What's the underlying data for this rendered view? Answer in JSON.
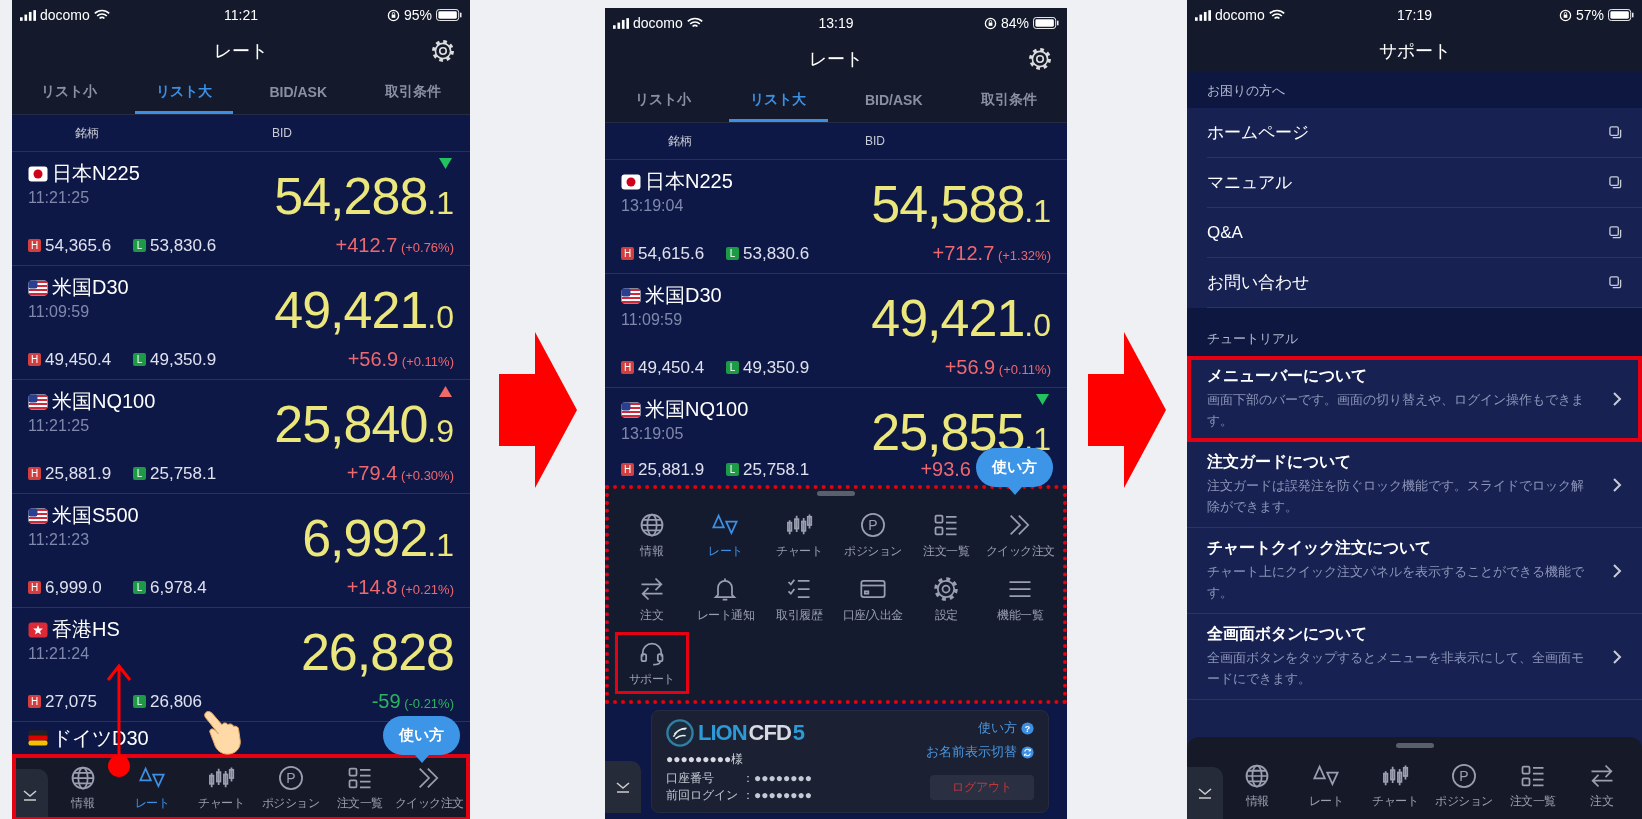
{
  "panels": [
    {
      "kind": "rates",
      "status_bar": {
        "carrier": "docomo",
        "time": "11:21",
        "battery": "95%"
      },
      "title": "レート",
      "tabs": [
        {
          "label": "リスト小",
          "selected": false
        },
        {
          "label": "リスト大",
          "selected": true
        },
        {
          "label": "BID/ASK",
          "selected": false
        },
        {
          "label": "取引条件",
          "selected": false
        }
      ],
      "columns": [
        "銘柄",
        "BID"
      ],
      "rows": [
        {
          "flag": {
            "kind": "jp"
          },
          "name": "日本N225",
          "time": "11:21:25",
          "price": "54,288",
          "price_decimal": ".1",
          "tick": {
            "kind": "down"
          },
          "high_badge": "H",
          "high": "54,365.6",
          "low_badge": "L",
          "low": "53,830.6",
          "rising": true,
          "change": "+412.7",
          "change_pct": "(+0.76%)"
        },
        {
          "flag": {
            "kind": "us"
          },
          "name": "米国D30",
          "time": "11:09:59",
          "price": "49,421",
          "price_decimal": ".0",
          "high_badge": "H",
          "high": "49,450.4",
          "low_badge": "L",
          "low": "49,350.9",
          "rising": true,
          "change": "+56.9",
          "change_pct": "(+0.11%)"
        },
        {
          "flag": {
            "kind": "us"
          },
          "name": "米国NQ100",
          "time": "11:21:25",
          "price": "25,840",
          "price_decimal": ".9",
          "tick": {
            "kind": "up"
          },
          "high_badge": "H",
          "high": "25,881.9",
          "low_badge": "L",
          "low": "25,758.1",
          "rising": true,
          "change": "+79.4",
          "change_pct": "(+0.30%)"
        },
        {
          "flag": {
            "kind": "us"
          },
          "name": "米国S500",
          "time": "11:21:23",
          "price": "6,992",
          "price_decimal": ".1",
          "high_badge": "H",
          "high": "6,999.0",
          "low_badge": "L",
          "low": "6,978.4",
          "rising": true,
          "change": "+14.8",
          "change_pct": "(+0.21%)"
        },
        {
          "flag": {
            "kind": "hk"
          },
          "name": "香港HS",
          "time": "11:21:24",
          "price": "26,828",
          "high_badge": "H",
          "high": "27,075",
          "low_badge": "L",
          "low": "26,806",
          "rising": false,
          "change": "-59",
          "change_pct": "(-0.21%)"
        }
      ],
      "cut_row": {
        "flag": {
          "kind": "de"
        },
        "name": "ドイツD30"
      },
      "help_bubble": "使い方",
      "nav": {
        "highlighted": true,
        "items": [
          {
            "kind": "info",
            "label": "情報",
            "selected": false
          },
          {
            "kind": "rate",
            "label": "レート",
            "selected": true
          },
          {
            "kind": "chart",
            "label": "チャート",
            "selected": false
          },
          {
            "kind": "position",
            "label": "ポジション",
            "icon_letter": "P",
            "selected": false
          },
          {
            "kind": "orders",
            "label": "注文一覧",
            "selected": false
          },
          {
            "kind": "quick",
            "label": "クイック注文",
            "selected": false
          }
        ]
      }
    },
    {
      "kind": "rates",
      "status_bar": {
        "carrier": "docomo",
        "time": "13:19",
        "battery": "84%"
      },
      "title": "レート",
      "tabs": [
        {
          "label": "リスト小",
          "selected": false
        },
        {
          "label": "リスト大",
          "selected": true
        },
        {
          "label": "BID/ASK",
          "selected": false
        },
        {
          "label": "取引条件",
          "selected": false
        }
      ],
      "columns": [
        "銘柄",
        "BID"
      ],
      "rows": [
        {
          "flag": {
            "kind": "jp"
          },
          "name": "日本N225",
          "time": "13:19:04",
          "price": "54,588",
          "price_decimal": ".1",
          "high_badge": "H",
          "high": "54,615.6",
          "low_badge": "L",
          "low": "53,830.6",
          "rising": true,
          "change": "+712.7",
          "change_pct": "(+1.32%)"
        },
        {
          "flag": {
            "kind": "us"
          },
          "name": "米国D30",
          "time": "11:09:59",
          "price": "49,421",
          "price_decimal": ".0",
          "high_badge": "H",
          "high": "49,450.4",
          "low_badge": "L",
          "low": "49,350.9",
          "rising": true,
          "change": "+56.9",
          "change_pct": "(+0.11%)"
        },
        {
          "flag": {
            "kind": "us"
          },
          "name": "米国NQ100",
          "time": "13:19:05",
          "price": "25,855",
          "price_decimal": ".1",
          "tick": {
            "kind": "down"
          },
          "high_badge": "H",
          "high": "25,881.9",
          "low_badge": "L",
          "low": "25,758.1",
          "rising": true,
          "change": "+93.6"
        }
      ],
      "help_bubble": "使い方",
      "menu_sheet": {
        "highlighted": true,
        "items": [
          {
            "kind": "info",
            "label": "情報",
            "selected": false,
            "highlighted": false
          },
          {
            "kind": "rate",
            "label": "レート",
            "selected": true,
            "highlighted": false
          },
          {
            "kind": "chart",
            "label": "チャート",
            "selected": false,
            "highlighted": false
          },
          {
            "kind": "position",
            "label": "ポジション",
            "icon_letter": "P",
            "selected": false,
            "highlighted": false
          },
          {
            "kind": "orders",
            "label": "注文一覧",
            "selected": false,
            "highlighted": false
          },
          {
            "kind": "quick",
            "label": "クイック注文",
            "selected": false,
            "highlighted": false
          },
          {
            "kind": "order",
            "label": "注文",
            "selected": false,
            "highlighted": false
          },
          {
            "kind": "alert",
            "label": "レート通知",
            "selected": false,
            "highlighted": false
          },
          {
            "kind": "history",
            "label": "取引履歴",
            "selected": false,
            "highlighted": false
          },
          {
            "kind": "account",
            "label": "口座/入出金",
            "selected": false,
            "highlighted": false
          },
          {
            "kind": "settings",
            "label": "設定",
            "selected": false,
            "highlighted": false
          },
          {
            "kind": "menu",
            "label": "機能一覧",
            "selected": false,
            "highlighted": false
          },
          {
            "kind": "support",
            "label": "サポート",
            "selected": false,
            "highlighted": true
          }
        ]
      },
      "account_card": {
        "logo_text": [
          "LION",
          "CFD",
          "5"
        ],
        "help_link": {
          "label": "使い方",
          "icon_text": "?"
        },
        "name_toggle": "お名前表示切替",
        "account_name": "●●●●●●●●●様",
        "fields": [
          {
            "label": "口座番号",
            "value": "：●●●●●●●●"
          },
          {
            "label": "前回ログイン",
            "value": "：●●●●●●●●"
          }
        ],
        "logout": "ログアウト"
      }
    },
    {
      "kind": "support",
      "status_bar": {
        "carrier": "docomo",
        "time": "17:19",
        "battery": "57%"
      },
      "title": "サポート",
      "sections": [
        {
          "kind": "links",
          "heading": "お困りの方へ",
          "items": [
            {
              "label": "ホームページ"
            },
            {
              "label": "マニュアル"
            },
            {
              "label": "Q&A"
            },
            {
              "label": "お問い合わせ"
            }
          ]
        },
        {
          "kind": "tutorials",
          "heading": "チュートリアル",
          "items": [
            {
              "title": "メニューバーについて",
              "description": "画面下部のバーです。画面の切り替えや、ログイン操作もできます。",
              "highlighted": true
            },
            {
              "title": "注文ガードについて",
              "description": "注文ガードは誤発注を防ぐロック機能です。スライドでロック解除ができます。",
              "highlighted": false
            },
            {
              "title": "チャートクイック注文について",
              "description": "チャート上にクイック注文パネルを表示することができる機能です。",
              "highlighted": false
            },
            {
              "title": "全画面ボタンについて",
              "description": "全画面ボタンをタップするとメニューを非表示にして、全画面モードにできます。",
              "highlighted": false
            }
          ]
        }
      ],
      "nav": {
        "highlighted": false,
        "handle": true,
        "items": [
          {
            "kind": "info",
            "label": "情報",
            "selected": false
          },
          {
            "kind": "rate",
            "label": "レート",
            "selected": false
          },
          {
            "kind": "chart",
            "label": "チャート",
            "selected": false
          },
          {
            "kind": "position",
            "label": "ポジション",
            "icon_letter": "P",
            "selected": false
          },
          {
            "kind": "orders",
            "label": "注文一覧",
            "selected": false
          },
          {
            "kind": "order",
            "label": "注文",
            "selected": false
          }
        ]
      }
    }
  ]
}
